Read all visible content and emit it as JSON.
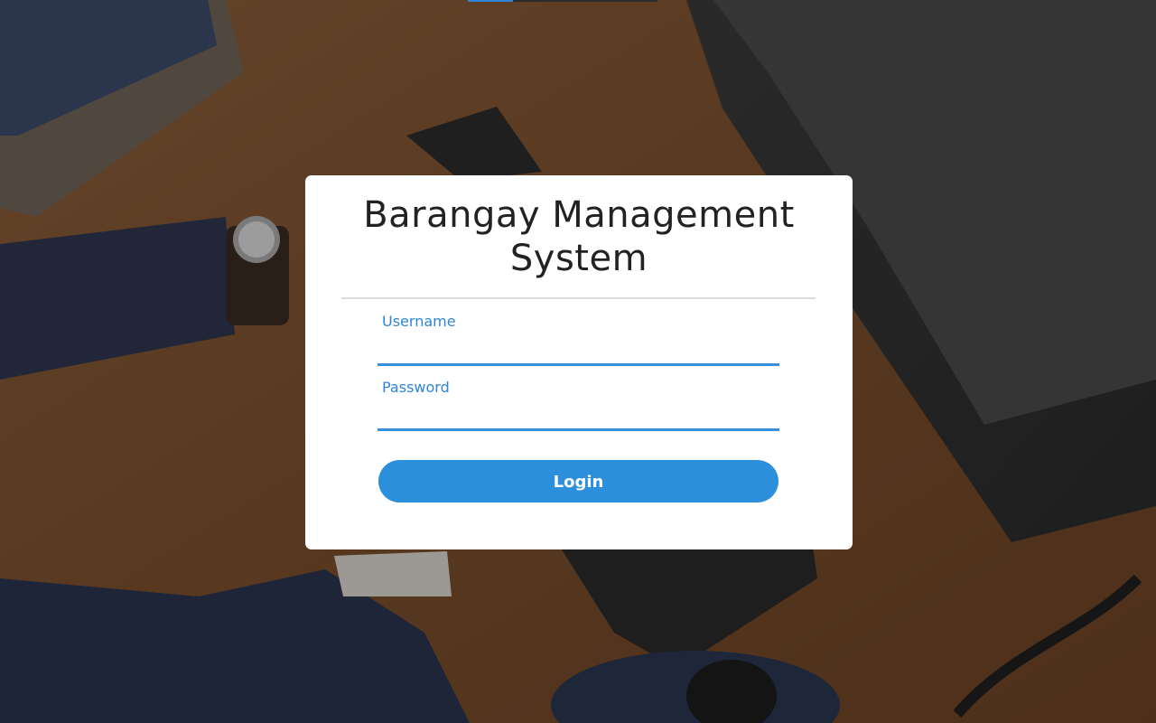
{
  "login_card": {
    "title": "Barangay Management System",
    "username_label": "Username",
    "username_value": "",
    "password_label": "Password",
    "password_value": "",
    "login_label": "Login"
  },
  "colors": {
    "accent": "#2b8fdc",
    "card_bg": "#ffffff",
    "title_text": "#222222"
  },
  "icons": {
    "background": "office-desk-photo"
  }
}
